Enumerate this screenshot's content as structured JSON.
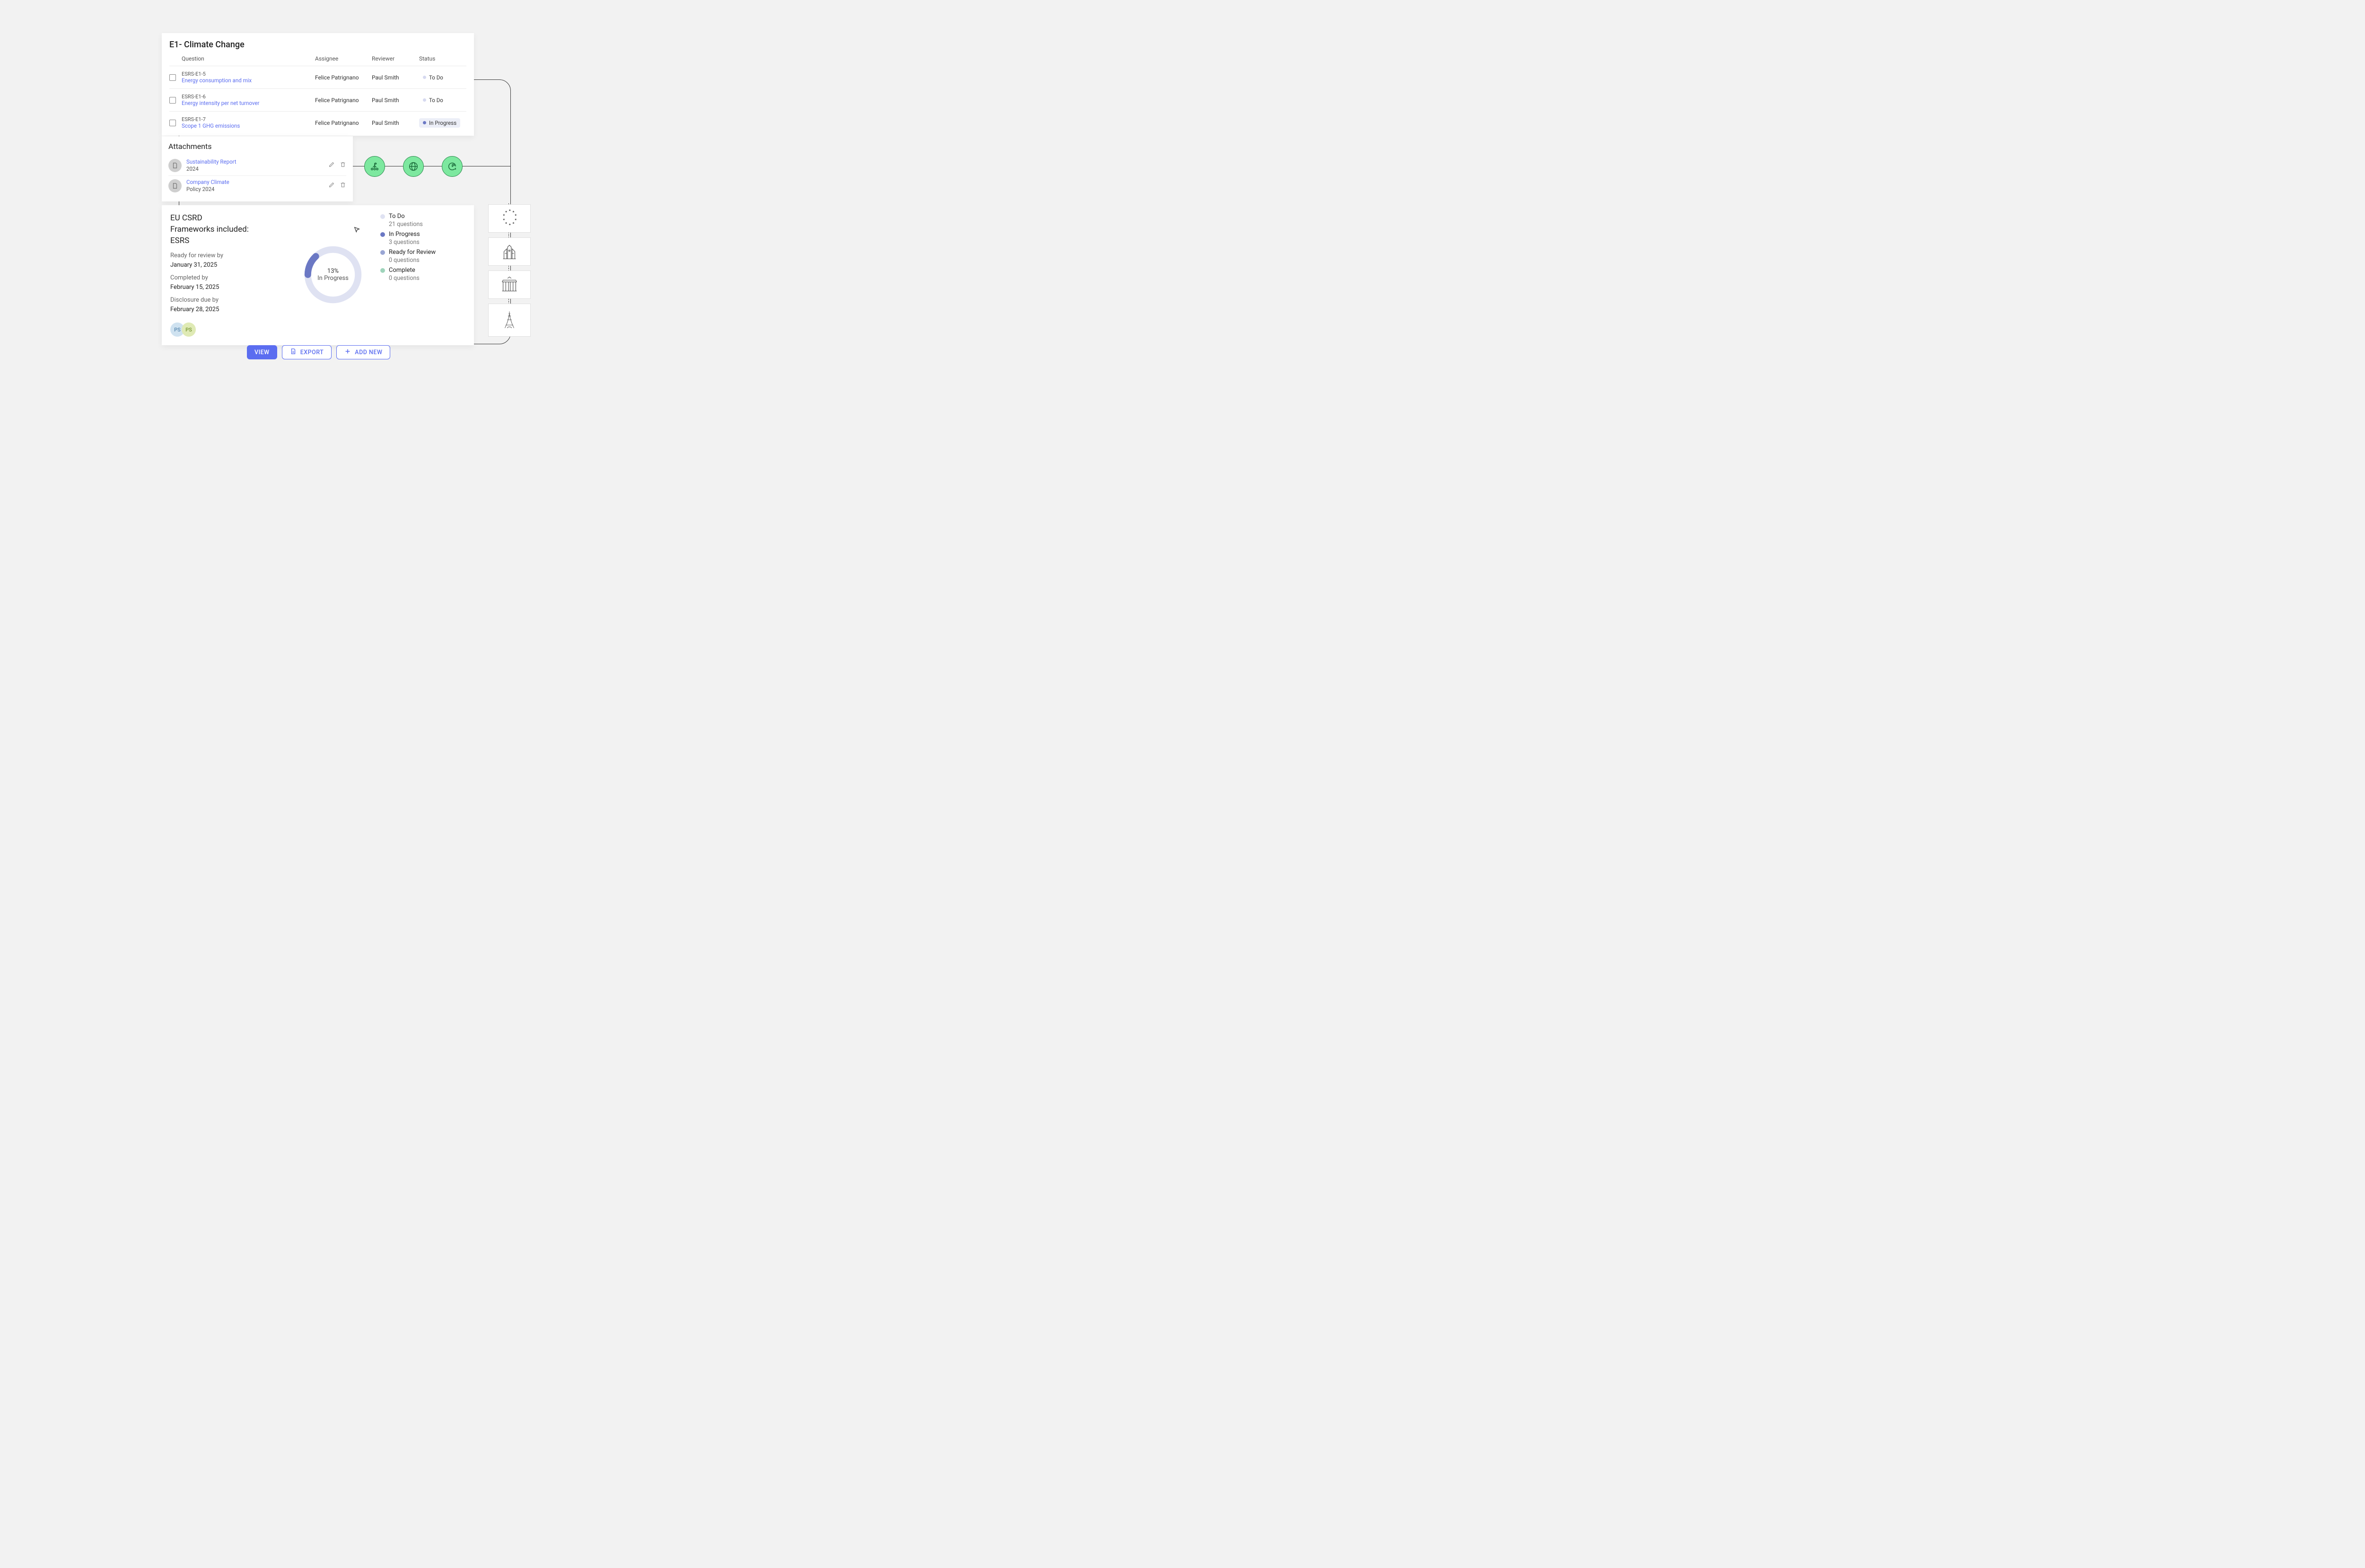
{
  "questions": {
    "title": "E1- Climate  Change",
    "headers": {
      "question": "Question",
      "assignee": "Assignee",
      "reviewer": "Reviewer",
      "status": "Status"
    },
    "rows": [
      {
        "code": "ESRS-E1-5",
        "desc": "Energy consumption and mix",
        "assignee": "Felice Patrignano",
        "reviewer": "Paul Smith",
        "status": "To Do",
        "status_kind": "todo"
      },
      {
        "code": "ESRS-E1-6",
        "desc": "Energy intensity per net turnover",
        "assignee": "Felice Patrignano",
        "reviewer": "Paul Smith",
        "status": "To Do",
        "status_kind": "todo"
      },
      {
        "code": "ESRS-E1-7",
        "desc": "Scope 1 GHG emissions",
        "assignee": "Felice Patrignano",
        "reviewer": "Paul Smith",
        "status": "In Progress",
        "status_kind": "inprogress"
      }
    ]
  },
  "attachments": {
    "title": "Attachments",
    "items": [
      {
        "name": "Sustainability Report",
        "sub": "2024"
      },
      {
        "name": "Company Climate",
        "sub": "Policy 2024"
      }
    ]
  },
  "summary": {
    "title_line1": "EU CSRD",
    "title_line2": "Frameworks included:",
    "title_line3": "ESRS",
    "dates": [
      {
        "label": "Ready for review by",
        "value": "January 31, 2025"
      },
      {
        "label": "Completed by",
        "value": "February 15, 2025"
      },
      {
        "label": "Disclosure due by",
        "value": "February 28, 2025"
      }
    ],
    "avatars": [
      {
        "initials": "PS",
        "variant": "blue"
      },
      {
        "initials": "PS",
        "variant": "green"
      }
    ],
    "donut": {
      "pct": "13%",
      "label": "In Progress"
    },
    "legend": [
      {
        "name": "To Do",
        "count": "21 questions",
        "color": "#dfe2f2"
      },
      {
        "name": "In Progress",
        "count": "3 questions",
        "color": "#6b78c4"
      },
      {
        "name": "Ready for Review",
        "count": "0 questions",
        "color": "#9aa6d4"
      },
      {
        "name": "Complete",
        "count": "0 questions",
        "color": "#9fd4bb"
      }
    ]
  },
  "buttons": {
    "view": "VIEW",
    "export": "EXPORT",
    "add": "ADD NEW"
  },
  "chart_data": {
    "type": "pie",
    "title": "",
    "series": [
      {
        "name": "To Do",
        "value": 21
      },
      {
        "name": "In Progress",
        "value": 3
      },
      {
        "name": "Ready for Review",
        "value": 0
      },
      {
        "name": "Complete",
        "value": 0
      }
    ],
    "center_label_pct": "13%",
    "center_label_text": "In Progress"
  }
}
